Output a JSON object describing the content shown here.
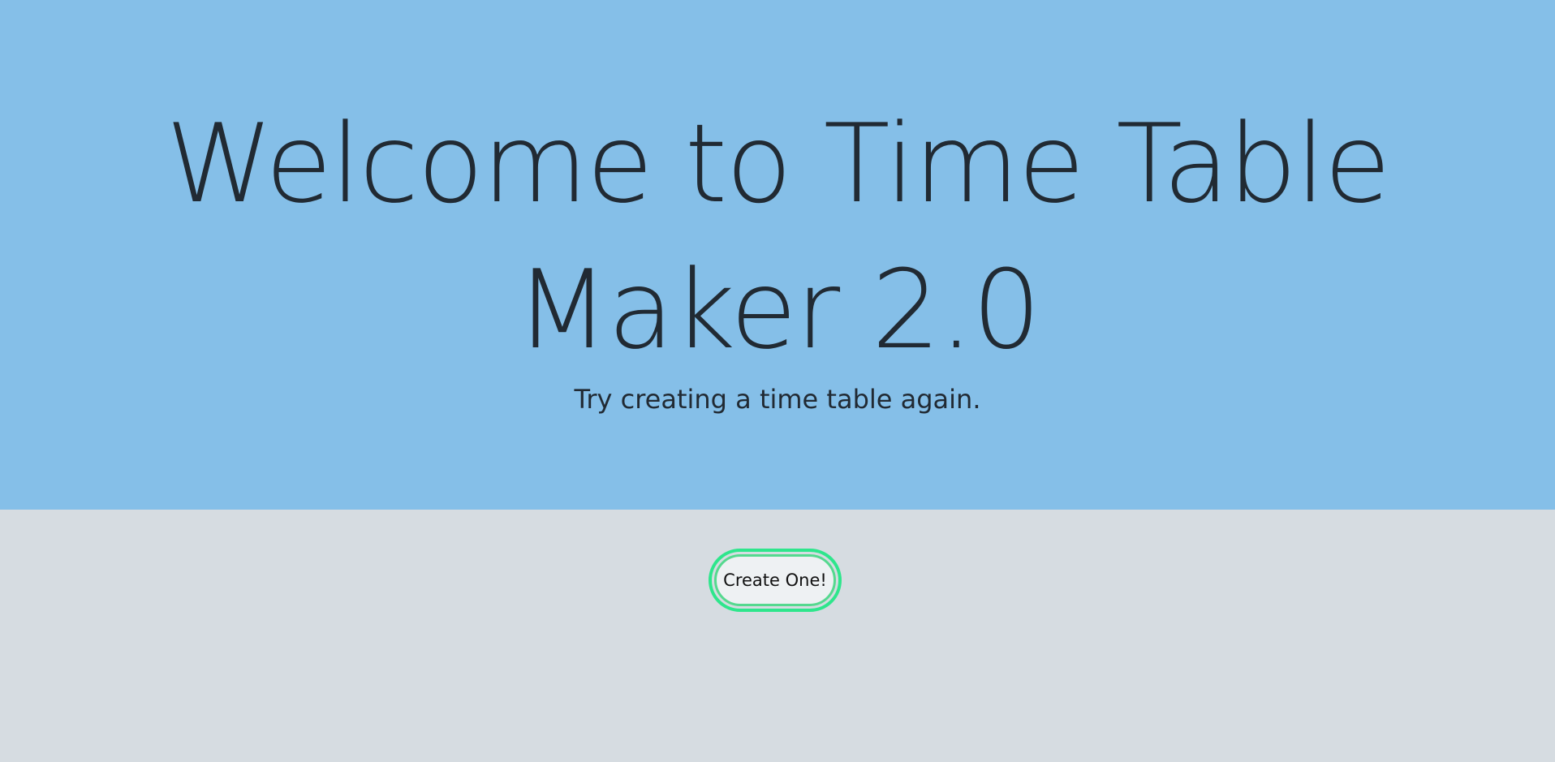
{
  "hero": {
    "title": "Welcome to Time Table Maker 2.0",
    "subtitle": "Try creating a time table again."
  },
  "actions": {
    "create_label": "Create One!"
  },
  "colors": {
    "hero_background": "#85bfe8",
    "page_background": "#d6dce1",
    "button_border": "#2ee68c",
    "text": "#212a33"
  }
}
